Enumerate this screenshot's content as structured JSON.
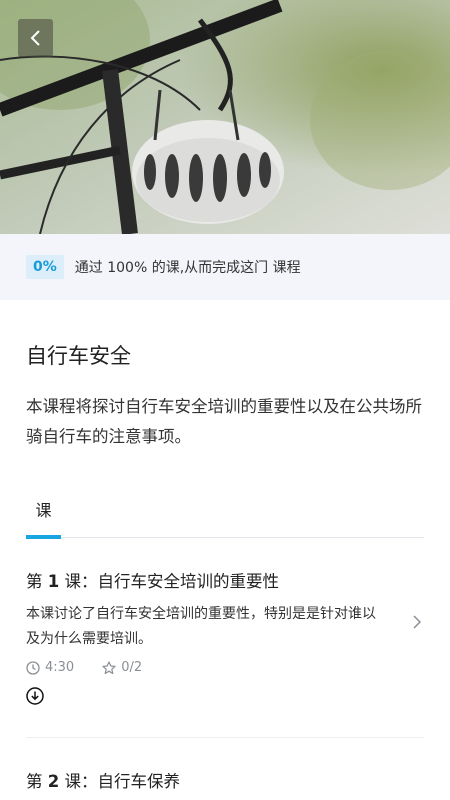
{
  "header": {
    "back_icon": "chevron-left-icon",
    "hero_image": "bicycle-helmet-photo"
  },
  "progress": {
    "percent": 0,
    "percent_label": "0%",
    "text": "通过 100% 的课,从而完成这门 课程"
  },
  "course": {
    "title": "自行车安全",
    "description": "本课程将探讨自行车安全培训的重要性以及在公共场所骑自行车的注意事项。"
  },
  "tabs": [
    {
      "label": "课",
      "active": true
    }
  ],
  "lessons": [
    {
      "prefix": "第 ",
      "number": "1",
      "suffix": " 课：自行车安全培训的重要性",
      "description": "本课讨论了自行车安全培训的重要性，特别是是针对谁以及为什么需要培训。",
      "duration": "4:30",
      "stars": "0/2",
      "icons": [
        "clock-icon",
        "star-icon",
        "download-icon",
        "chevron-right-icon"
      ]
    },
    {
      "prefix": "第 ",
      "number": "2",
      "suffix": " 课：自行车保养"
    }
  ],
  "colors": {
    "accent": "#19a6e0",
    "banner_bg": "#f3f5fa",
    "badge_bg": "#dbeefa"
  }
}
